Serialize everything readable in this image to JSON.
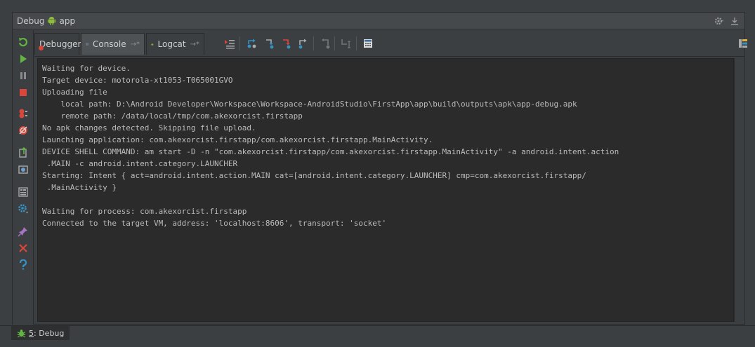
{
  "window": {
    "title_prefix": "Debug",
    "app_name": "app"
  },
  "tabs": [
    {
      "label": "Debugger"
    },
    {
      "label": "Console"
    },
    {
      "label": "Logcat"
    }
  ],
  "console": {
    "lines": [
      "Waiting for device.",
      "Target device: motorola-xt1053-T065001GVO",
      "Uploading file",
      "    local path: D:\\Android Developer\\Workspace\\Workspace-AndroidStudio\\FirstApp\\app\\build\\outputs\\apk\\app-debug.apk",
      "    remote path: /data/local/tmp/com.akexorcist.firstapp",
      "No apk changes detected. Skipping file upload.",
      "Launching application: com.akexorcist.firstapp/com.akexorcist.firstapp.MainActivity.",
      "DEVICE SHELL COMMAND: am start -D -n \"com.akexorcist.firstapp/com.akexorcist.firstapp.MainActivity\" -a android.intent.action",
      " .MAIN -c android.intent.category.LAUNCHER",
      "Starting: Intent { act=android.intent.action.MAIN cat=[android.intent.category.LAUNCHER] cmp=com.akexorcist.firstapp/",
      " .MainActivity }",
      "",
      "Waiting for process: com.akexorcist.firstapp",
      "Connected to the target VM, address: 'localhost:8606', transport: 'socket'"
    ]
  },
  "bottom": {
    "debug_tab_number": "5",
    "debug_tab_label": ": Debug"
  },
  "colors": {
    "background": "#3c3f41",
    "console_bg": "#2b2b2b",
    "text": "#bbbbbb",
    "green": "#62b543",
    "red": "#d9463b",
    "blue": "#3592c4"
  }
}
